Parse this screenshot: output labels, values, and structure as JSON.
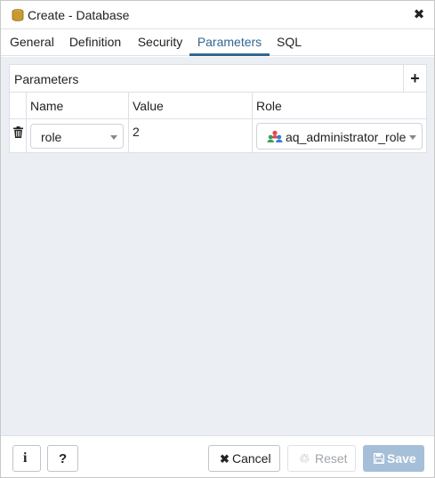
{
  "dialog": {
    "title": "Create - Database",
    "close_symbol": "✖",
    "icons": {
      "title": "database-icon",
      "close": "close-icon"
    }
  },
  "tabs": [
    {
      "label": "General"
    },
    {
      "label": "Definition"
    },
    {
      "label": "Security"
    },
    {
      "label": "Parameters",
      "active": true
    },
    {
      "label": "SQL"
    }
  ],
  "parameters": {
    "title": "Parameters",
    "add_symbol": "+",
    "columns": [
      "Name",
      "Value",
      "Role"
    ],
    "rows": [
      {
        "name": "role",
        "value": "2",
        "role": "aq_administrator_role"
      }
    ]
  },
  "footer": {
    "info_symbol": "i",
    "help_symbol": "?",
    "cancel_symbol": "✖",
    "cancel_label": "Cancel",
    "reset_symbol": "♲",
    "reset_label": "Reset",
    "save_label": "Save"
  },
  "colors": {
    "accent": "#326690",
    "content_bg": "#ebeef3",
    "save_disabled": "#a6bfd8",
    "border": "#dde0e6"
  }
}
